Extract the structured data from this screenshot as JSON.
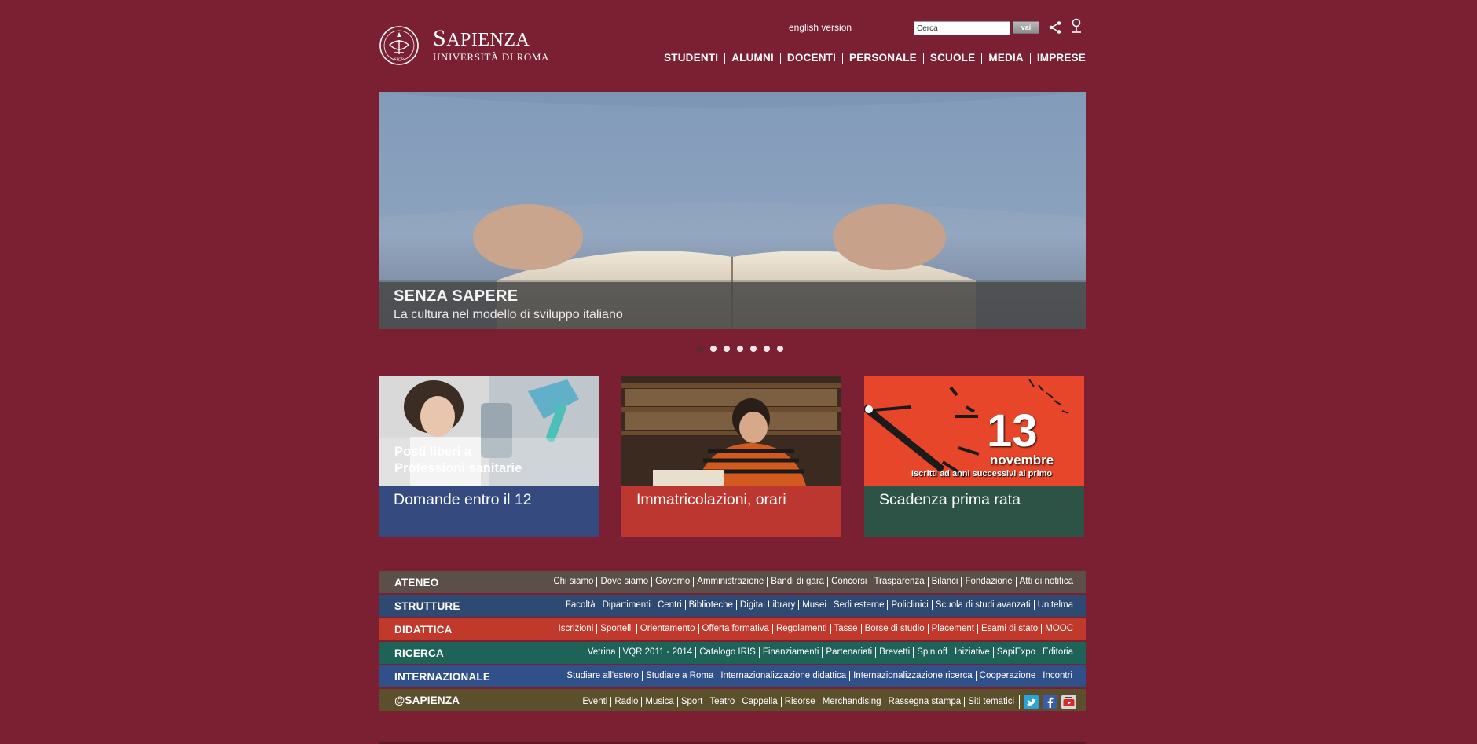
{
  "header": {
    "logo_name_cap": "S",
    "logo_name_rest": "APIENZA",
    "logo_subtitle": "Università di Roma",
    "logo_seal_text": "SPQR",
    "english_link": "english version",
    "search": {
      "value": "Cerca",
      "button_label": "vai"
    },
    "share_icon": "share-icon",
    "location_icon": "map-pin-icon"
  },
  "main_nav": [
    "STUDENTI",
    "ALUMNI",
    "DOCENTI",
    "PERSONALE",
    "SCUOLE",
    "MEDIA",
    "IMPRESE"
  ],
  "hero": {
    "title": "SENZA SAPERE",
    "subtitle": "La cultura nel modello di sviluppo italiano",
    "slide_count": 7,
    "active_slide": 1
  },
  "cards": [
    {
      "overlay_line1": "Posti liberi a",
      "overlay_line2": "Professioni sanitarie",
      "label": "Domande entro il 12",
      "band_color": "#2f4e86"
    },
    {
      "label": "Immatricolazioni, orari",
      "band_color": "#c23a2f"
    },
    {
      "big_number": "13",
      "month": "novembre",
      "note": "Iscritti ad anni successivi al primo",
      "label": "Scadenza prima rata",
      "band_color": "#2d5246"
    }
  ],
  "nav_bars": [
    {
      "title": "ATENEO",
      "color": "#5c4e48",
      "links": [
        "Chi siamo",
        "Dove siamo",
        "Governo",
        "Amministrazione",
        "Bandi di gara",
        "Concorsi",
        "Trasparenza",
        "Bilanci",
        "Fondazione",
        "Atti di notifica"
      ]
    },
    {
      "title": "STRUTTURE",
      "color": "#2e4a72",
      "links": [
        "Facoltà",
        "Dipartimenti",
        "Centri",
        "Biblioteche",
        "Digital Library",
        "Musei",
        "Sedi esterne",
        "Policlinici",
        "Scuola di studi avanzati",
        "Unitelma"
      ]
    },
    {
      "title": "DIDATTICA",
      "color": "#c0392b",
      "links": [
        "Iscrizioni",
        "Sportelli",
        "Orientamento",
        "Offerta formativa",
        "Regolamenti",
        "Tasse",
        "Borse di studio",
        "Placement",
        "Esami di stato",
        "MOOC"
      ]
    },
    {
      "title": "RICERCA",
      "color": "#1e6358",
      "links": [
        "Vetrina",
        "VQR 2011 - 2014",
        "Catalogo IRIS",
        "Finanziamenti",
        "Partenariati",
        "Brevetti",
        "Spin off",
        "Iniziative",
        "SapiExpo",
        "Editoria"
      ]
    },
    {
      "title": "INTERNAZIONALE",
      "color": "#30508a",
      "links": [
        "Studiare all'estero",
        "Studiare a Roma",
        "Internazionalizzazione didattica",
        "Internazionalizzazione ricerca",
        "Cooperazione",
        "Incontri"
      ]
    },
    {
      "title": "@SAPIENZA",
      "color": "#5b4f2c",
      "links": [
        "Eventi",
        "Radio",
        "Musica",
        "Sport",
        "Teatro",
        "Cappella",
        "Risorse",
        "Merchandising",
        "Rassegna stampa",
        "Siti tematici"
      ],
      "social": [
        "twitter-icon",
        "facebook-icon",
        "youtube-icon"
      ]
    }
  ]
}
